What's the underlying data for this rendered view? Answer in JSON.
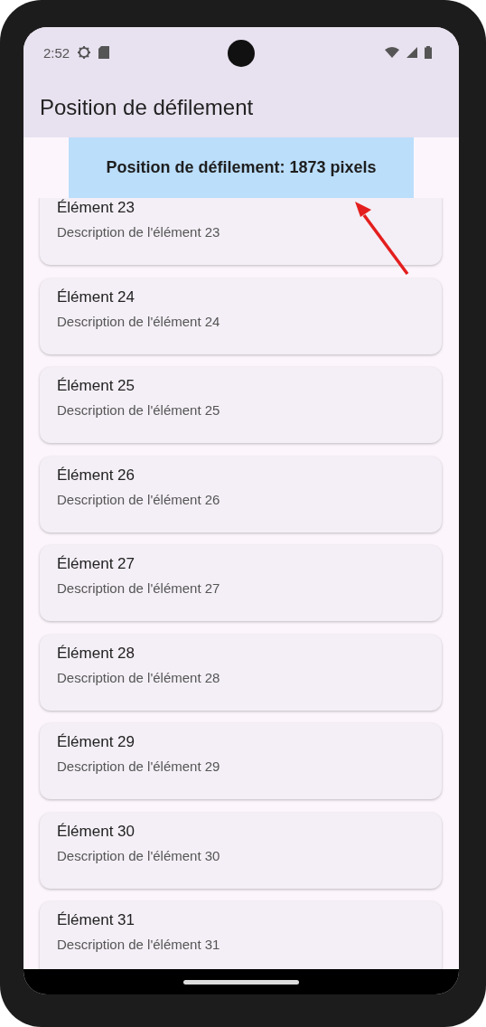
{
  "status_bar": {
    "time": "2:52"
  },
  "app_bar": {
    "title": "Position de défilement"
  },
  "scroll_banner": {
    "text": "Position de défilement: 1873 pixels"
  },
  "items": [
    {
      "title": "Élément 23",
      "description": "Description de l'élément 23"
    },
    {
      "title": "Élément 24",
      "description": "Description de l'élément 24"
    },
    {
      "title": "Élément 25",
      "description": "Description de l'élément 25"
    },
    {
      "title": "Élément 26",
      "description": "Description de l'élément 26"
    },
    {
      "title": "Élément 27",
      "description": "Description de l'élément 27"
    },
    {
      "title": "Élément 28",
      "description": "Description de l'élément 28"
    },
    {
      "title": "Élément 29",
      "description": "Description de l'élément 29"
    },
    {
      "title": "Élément 30",
      "description": "Description de l'élément 30"
    },
    {
      "title": "Élément 31",
      "description": "Description de l'élément 31"
    }
  ]
}
